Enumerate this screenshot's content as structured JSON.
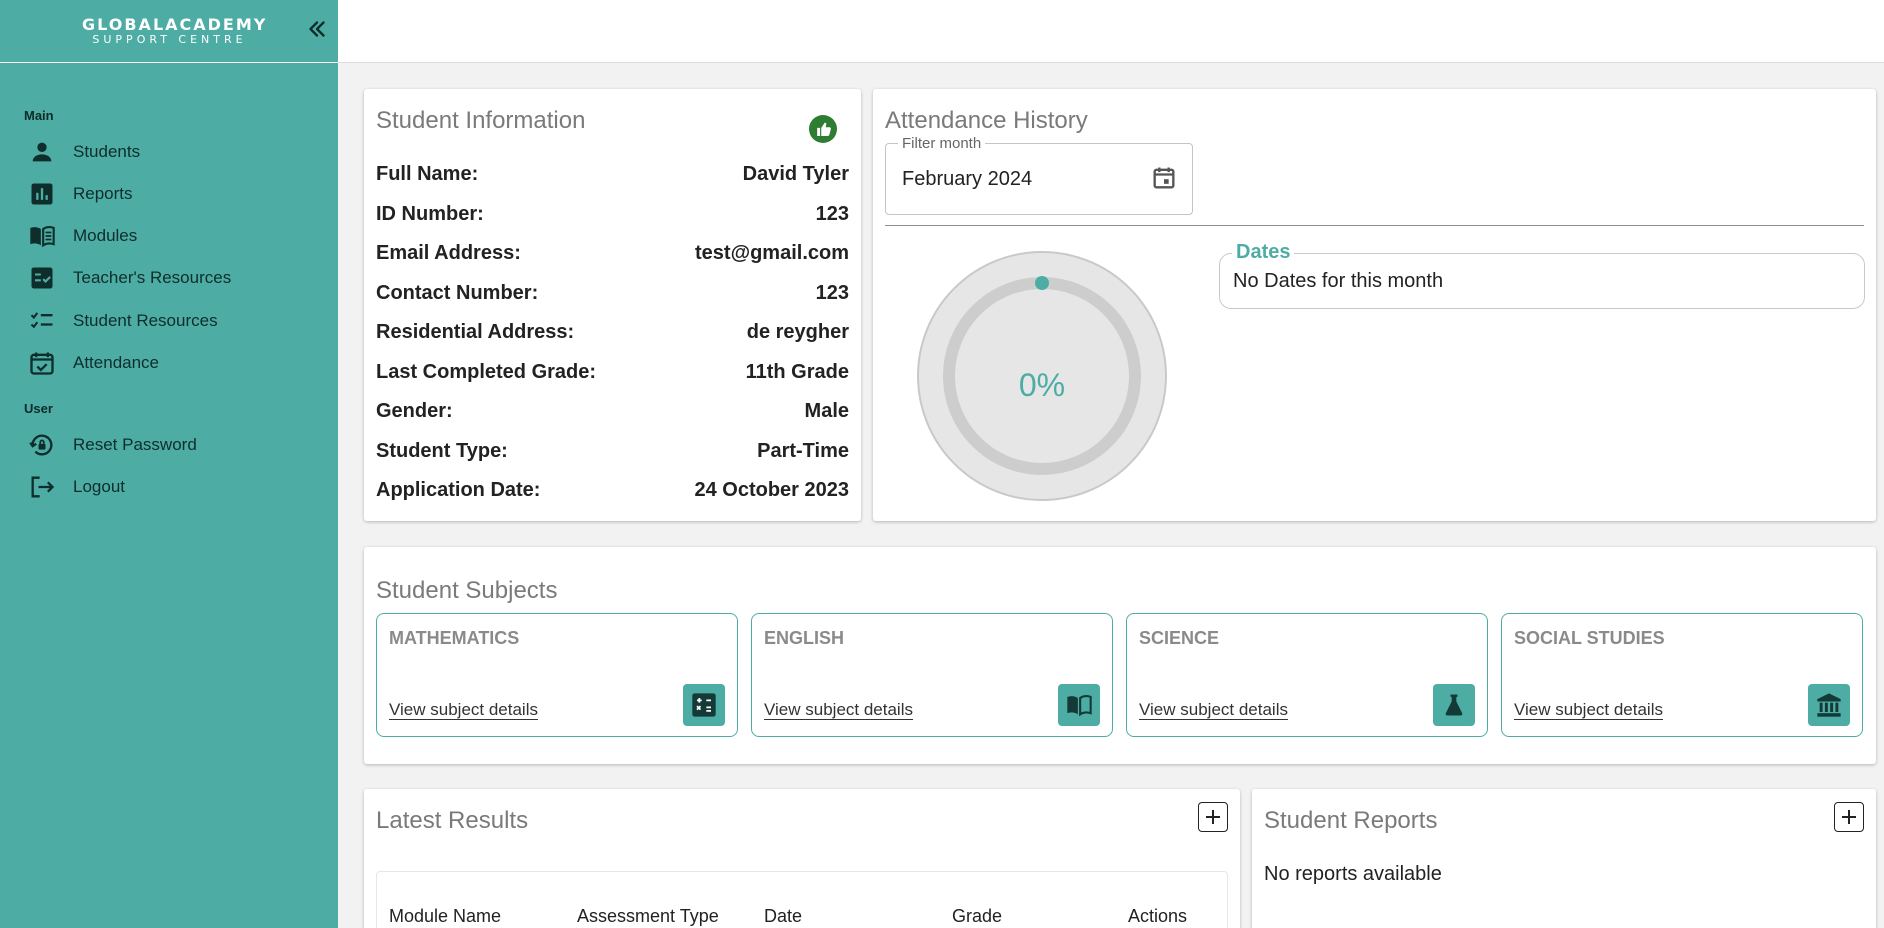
{
  "brand": {
    "line1": "GLOBALACADEMY",
    "line2": "SUPPORT CENTRE"
  },
  "sidebar": {
    "main_label": "Main",
    "user_label": "User",
    "items": [
      {
        "label": "Students",
        "icon": "person-icon"
      },
      {
        "label": "Reports",
        "icon": "bar-chart-icon"
      },
      {
        "label": "Modules",
        "icon": "book-icon"
      },
      {
        "label": "Teacher's Resources",
        "icon": "checklist-box-icon"
      },
      {
        "label": "Student Resources",
        "icon": "checklist-icon"
      },
      {
        "label": "Attendance",
        "icon": "calendar-check-icon"
      }
    ],
    "user_items": [
      {
        "label": "Reset Password",
        "icon": "lock-reset-icon"
      },
      {
        "label": "Logout",
        "icon": "logout-icon"
      }
    ]
  },
  "student_info": {
    "title": "Student Information",
    "rows": [
      {
        "label": "Full Name:",
        "value": "David Tyler"
      },
      {
        "label": "ID Number:",
        "value": "123"
      },
      {
        "label": "Email Address:",
        "value": "test@gmail.com"
      },
      {
        "label": "Contact Number:",
        "value": "123"
      },
      {
        "label": "Residential Address:",
        "value": "de reygher"
      },
      {
        "label": "Last Completed Grade:",
        "value": "11th Grade"
      },
      {
        "label": "Gender:",
        "value": "Male"
      },
      {
        "label": "Student Type:",
        "value": "Part-Time"
      },
      {
        "label": "Application Date:",
        "value": "24 October 2023"
      }
    ]
  },
  "attendance": {
    "title": "Attendance History",
    "filter_label": "Filter month",
    "filter_value": "February 2024",
    "percent_text": "0%",
    "percent_value": 0,
    "dates_label": "Dates",
    "dates_empty": "No Dates for this month"
  },
  "subjects": {
    "title": "Student Subjects",
    "link_label": "View subject details",
    "items": [
      {
        "name": "MATHEMATICS",
        "icon": "calculator-icon"
      },
      {
        "name": "ENGLISH",
        "icon": "open-book-icon"
      },
      {
        "name": "SCIENCE",
        "icon": "flask-icon"
      },
      {
        "name": "SOCIAL STUDIES",
        "icon": "institution-icon"
      }
    ]
  },
  "results": {
    "title": "Latest Results",
    "columns": [
      "Module Name",
      "Assessment Type",
      "Date",
      "Grade",
      "Actions"
    ]
  },
  "reports": {
    "title": "Student Reports",
    "empty": "No reports available"
  },
  "colors": {
    "accent": "#4dada5",
    "thumb": "#2e7d32"
  }
}
